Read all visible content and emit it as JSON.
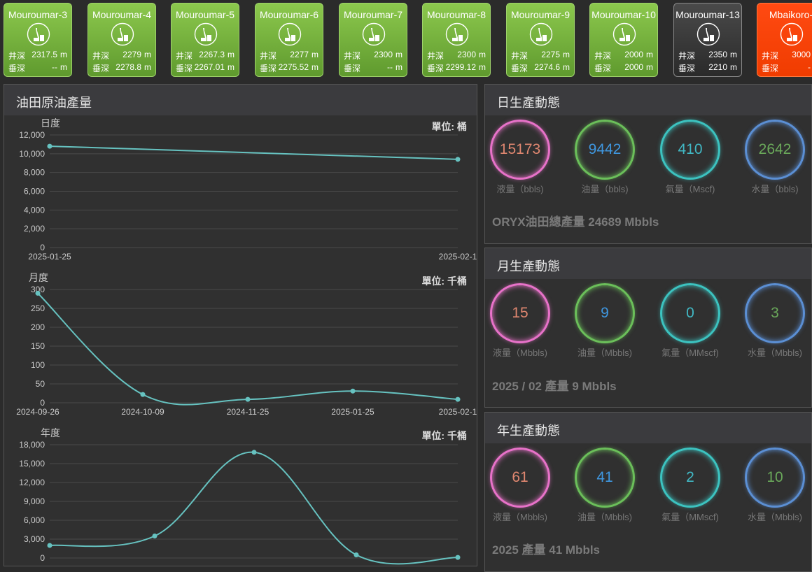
{
  "wells": [
    {
      "name": "Mouroumar-3",
      "depth_label": "井深",
      "depth": "2317.5",
      "vdepth_label": "垂深",
      "vdepth": "--",
      "unit": "m",
      "status": "green"
    },
    {
      "name": "Mouroumar-4",
      "depth_label": "井深",
      "depth": "2279",
      "vdepth_label": "垂深",
      "vdepth": "2278.8",
      "unit": "m",
      "status": "green"
    },
    {
      "name": "Mouroumar-5",
      "depth_label": "井深",
      "depth": "2267.3",
      "vdepth_label": "垂深",
      "vdepth": "2267.01",
      "unit": "m",
      "status": "green"
    },
    {
      "name": "Mouroumar-6",
      "depth_label": "井深",
      "depth": "2277",
      "vdepth_label": "垂深",
      "vdepth": "2275.52",
      "unit": "m",
      "status": "green"
    },
    {
      "name": "Mouroumar-7",
      "depth_label": "井深",
      "depth": "2300",
      "vdepth_label": "垂深",
      "vdepth": "--",
      "unit": "m",
      "status": "green"
    },
    {
      "name": "Mouroumar-8",
      "depth_label": "井深",
      "depth": "2300",
      "vdepth_label": "垂深",
      "vdepth": "2299.12",
      "unit": "m",
      "status": "green"
    },
    {
      "name": "Mouroumar-9",
      "depth_label": "井深",
      "depth": "2275",
      "vdepth_label": "垂深",
      "vdepth": "2274.6",
      "unit": "m",
      "status": "green"
    },
    {
      "name": "Mouroumar-10",
      "depth_label": "井深",
      "depth": "2000",
      "vdepth_label": "垂深",
      "vdepth": "2000",
      "unit": "m",
      "status": "green"
    },
    {
      "name": "Mouroumar-13",
      "depth_label": "井深",
      "depth": "2350",
      "vdepth_label": "垂深",
      "vdepth": "2210",
      "unit": "m",
      "status": "gray"
    },
    {
      "name": "Mbaikoro-",
      "depth_label": "井深",
      "depth": "3000",
      "vdepth_label": "垂深",
      "vdepth": "-",
      "unit": "m",
      "status": "orange"
    }
  ],
  "production": {
    "title": "油田原油產量",
    "line_color": "#66c2c0",
    "grid_color": "#4a4a4a"
  },
  "chart_data": [
    {
      "type": "line",
      "title": "日度",
      "unit_label": "單位: 桶",
      "x": [
        "2025-01-25",
        "2025-02-1"
      ],
      "values": [
        10800,
        9400
      ],
      "ylim": [
        0,
        12000
      ],
      "yticks": [
        "12,000",
        "10,000",
        "8,000",
        "6,000",
        "4,000",
        "2,000",
        "0"
      ],
      "grid": true
    },
    {
      "type": "line",
      "title": "月度",
      "unit_label": "單位: 千桶",
      "x": [
        "2024-09-26",
        "2024-10-09",
        "2024-11-25",
        "2025-01-25",
        "2025-02-1"
      ],
      "values": [
        290,
        22,
        9,
        31,
        9
      ],
      "ylim": [
        0,
        300
      ],
      "yticks": [
        "300",
        "250",
        "200",
        "150",
        "100",
        "50",
        "0"
      ],
      "grid": true
    },
    {
      "type": "line",
      "title": "年度",
      "unit_label": "單位: 千桶",
      "x": [
        "",
        "",
        "",
        "",
        ""
      ],
      "values": [
        2000,
        3500,
        16800,
        500,
        100
      ],
      "ylim": [
        0,
        18000
      ],
      "yticks": [
        "18,000",
        "15,000",
        "12,000",
        "9,000",
        "6,000",
        "3,000",
        "0"
      ],
      "grid": true
    }
  ],
  "daily": {
    "title": "日生產動態",
    "stats": [
      {
        "value": "15173",
        "label": "液量（bbls)"
      },
      {
        "value": "9442",
        "label": "油量（bbls)"
      },
      {
        "value": "410",
        "label": "氣量（Mscf)"
      },
      {
        "value": "2642",
        "label": "水量（bbls)"
      }
    ],
    "total": "ORYX油田總產量 24689 Mbbls"
  },
  "monthly": {
    "title": "月生產動態",
    "stats": [
      {
        "value": "15",
        "label": "液量（Mbbls)"
      },
      {
        "value": "9",
        "label": "油量（Mbbls)"
      },
      {
        "value": "0",
        "label": "氣量（MMscf)"
      },
      {
        "value": "3",
        "label": "水量（Mbbls)"
      }
    ],
    "total": "2025 / 02 產量 9 Mbbls"
  },
  "yearly": {
    "title": "年生產動態",
    "stats": [
      {
        "value": "61",
        "label": "液量（Mbbls)"
      },
      {
        "value": "41",
        "label": "油量（Mbbls)"
      },
      {
        "value": "2",
        "label": "氣量（MMscf)"
      },
      {
        "value": "10",
        "label": "水量（Mbbls)"
      }
    ],
    "total": "2025 產量 41 Mbbls"
  }
}
